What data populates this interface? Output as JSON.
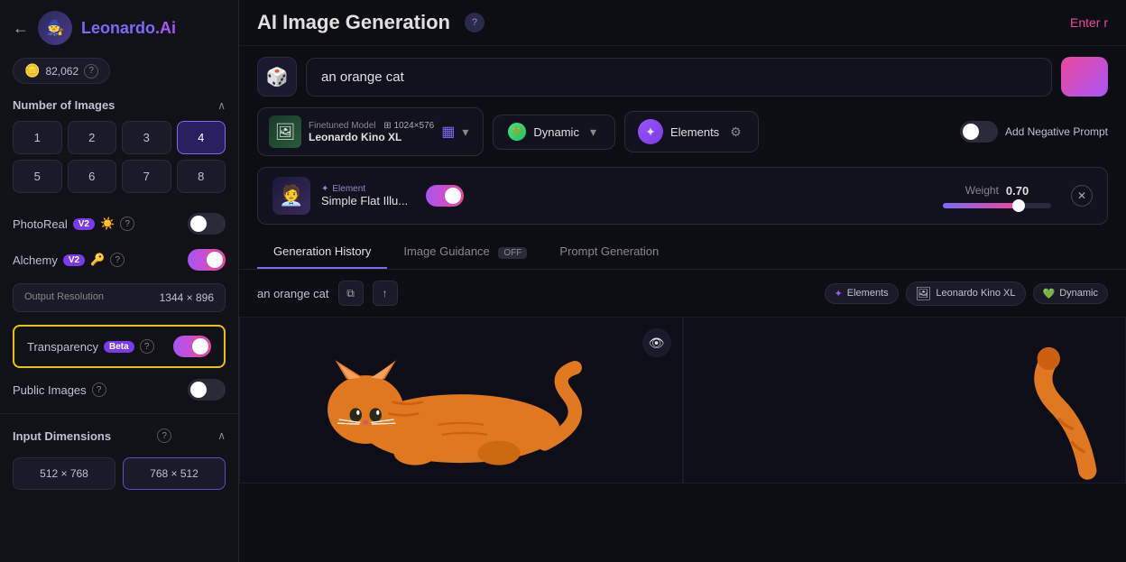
{
  "sidebar": {
    "back_icon": "←",
    "logo_emoji": "🧙",
    "logo_text_main": "Leonardo",
    "logo_text_accent": ".Ai",
    "credits": {
      "icon": "🪙",
      "value": "82,062",
      "help": "?"
    },
    "number_of_images": {
      "title": "Number of Images",
      "values": [
        "1",
        "2",
        "3",
        "4",
        "5",
        "6",
        "7",
        "8"
      ],
      "active": "4"
    },
    "photo_real": {
      "label": "PhotoReal",
      "badge": "V2",
      "icon": "☀️",
      "help": "?",
      "enabled": false
    },
    "alchemy": {
      "label": "Alchemy",
      "badge": "V2",
      "icon": "🔑",
      "help": "?",
      "enabled": true
    },
    "output_resolution": {
      "label": "Output Resolution",
      "value": "1344 × 896"
    },
    "transparency": {
      "label": "Transparency",
      "badge": "Beta",
      "help": "?",
      "enabled": true
    },
    "public_images": {
      "label": "Public Images",
      "help": "?",
      "enabled": false
    },
    "input_dimensions": {
      "title": "Input Dimensions",
      "help": "?",
      "options": [
        "512 × 768",
        "768 × 512"
      ],
      "active": "768 × 512"
    }
  },
  "main": {
    "title": "AI Image Generation",
    "help": "?",
    "enter_btn": "Enter r",
    "prompt": {
      "dice_icon": "🎲",
      "value": "an orange cat",
      "placeholder": "an orange cat"
    },
    "model": {
      "tag": "Finetuned Model",
      "size": "⊞ 1024×576",
      "name": "Leonardo Kino XL",
      "thumb_emoji": "🖼"
    },
    "style": {
      "name": "Dynamic",
      "icon": "💚"
    },
    "elements": {
      "label": "Elements",
      "icon": "⚙"
    },
    "neg_prompt": {
      "label": "Add Negative Prompt",
      "enabled": false
    },
    "element_card": {
      "thumb_emoji": "🧑‍💼",
      "tag": "Element",
      "tag_icon": "✦",
      "name": "Simple Flat Illu...",
      "toggle_on": true,
      "weight_label": "Weight",
      "weight_value": "0.70"
    },
    "tabs": [
      {
        "label": "Generation History",
        "active": true
      },
      {
        "label": "Image Guidance",
        "active": false,
        "badge": "OFF"
      },
      {
        "label": "Prompt Generation",
        "active": false
      }
    ],
    "gallery": {
      "prompt_text": "an orange cat",
      "copy_icon": "⧉",
      "upload_icon": "↑",
      "tags": [
        {
          "label": "Elements",
          "color": "purple",
          "icon": "✦"
        },
        {
          "label": "Leonardo Kino XL",
          "color": "gray"
        },
        {
          "label": "Dynamic",
          "color": "green",
          "icon": "💚"
        }
      ],
      "visibility_icon": "👁",
      "images": [
        {
          "alt": "orange cat lying down",
          "has_visibility": true
        },
        {
          "alt": "orange cat tail",
          "has_visibility": false
        }
      ]
    }
  }
}
